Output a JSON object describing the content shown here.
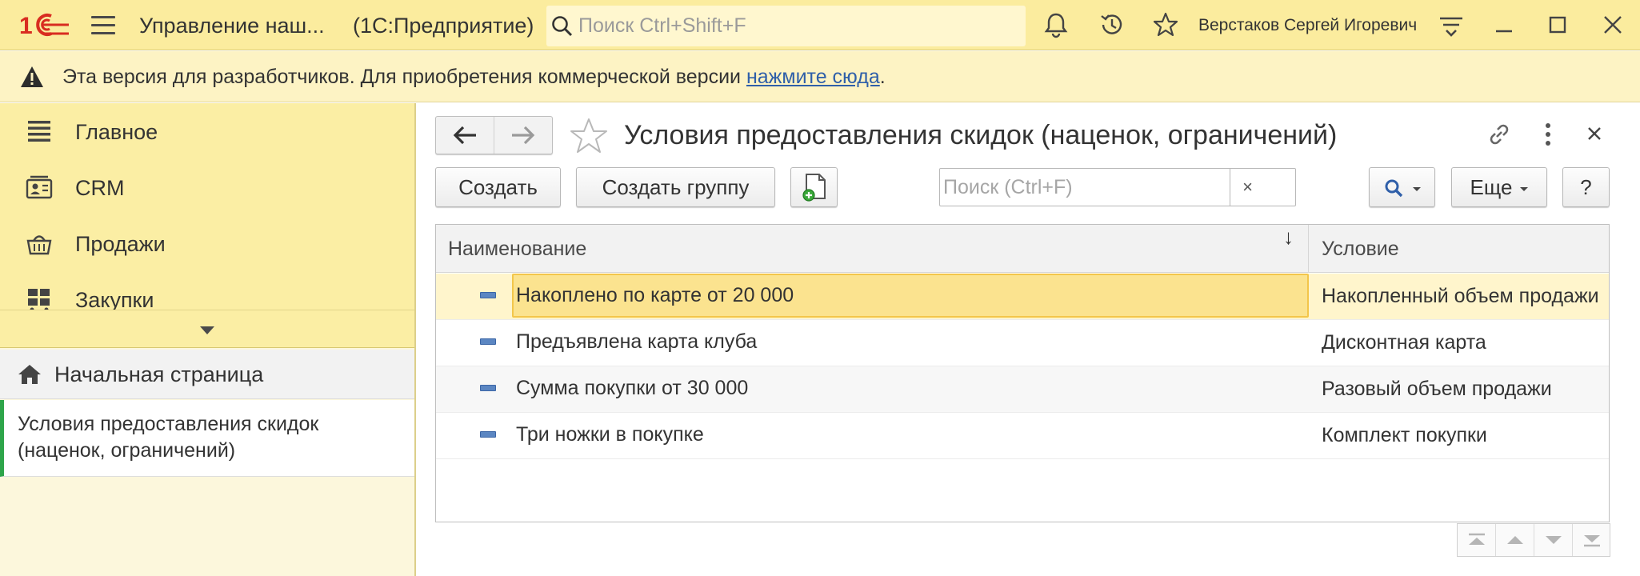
{
  "titlebar": {
    "app_title": "Управление наш...",
    "platform": "(1С:Предприятие)",
    "search_placeholder": "Поиск Ctrl+Shift+F",
    "user_name": "Верстаков Сергей Игоревич"
  },
  "warning": {
    "text": "Эта версия для разработчиков. Для приобретения коммерческой версии ",
    "link": "нажмите сюда",
    "tail": "."
  },
  "sidebar": {
    "sections": [
      {
        "label": "Главное",
        "icon": "list-icon"
      },
      {
        "label": "CRM",
        "icon": "contact-card-icon"
      },
      {
        "label": "Продажи",
        "icon": "basket-icon"
      },
      {
        "label": "Закупки",
        "icon": "cart-icon"
      }
    ],
    "home": "Начальная страница",
    "open_form": "Условия предоставления скидок (наценок, ограничений)"
  },
  "form": {
    "title": "Условия предоставления скидок (наценок, ограничений)",
    "buttons": {
      "create": "Создать",
      "create_group": "Создать группу",
      "more": "Еще",
      "help": "?"
    },
    "search_placeholder": "Поиск (Ctrl+F)",
    "clear": "×"
  },
  "table": {
    "columns": [
      "Наименование",
      "Условие"
    ],
    "sort_indicator": "↓",
    "rows": [
      {
        "name": "Накоплено по карте от 20 000",
        "condition": "Накопленный объем продажи",
        "selected": true
      },
      {
        "name": "Предъявлена карта клуба",
        "condition": "Дисконтная карта",
        "selected": false
      },
      {
        "name": "Сумма покупки от 30 000",
        "condition": "Разовый объем продажи",
        "selected": false
      },
      {
        "name": "Три ножки в покупке",
        "condition": "Комплект покупки",
        "selected": false
      }
    ]
  },
  "colors": {
    "titlebar": "#fbec9e",
    "warning": "#fdf3c4",
    "sidebar_sections": "#fbeea4",
    "selection": "#fbe38f",
    "active_marker": "#2ea54a",
    "link": "#2f5fa9",
    "logo_red": "#d82c20"
  }
}
